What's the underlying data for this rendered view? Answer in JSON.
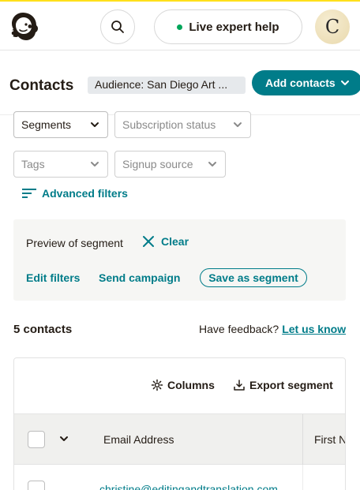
{
  "topbar": {
    "logo_icon": "mailchimp-freddie-icon",
    "search_icon": "search-icon",
    "expert_help_label": "Live expert help",
    "status_color": "#00a65a",
    "avatar_initial": "C"
  },
  "header": {
    "title": "Contacts",
    "audience": "Audience: San Diego Art ...",
    "add_contacts_label": "Add contacts",
    "accent_color": "#007c89"
  },
  "filters": {
    "segments": "Segments",
    "subscription_status": "Subscription status",
    "tags": "Tags",
    "signup_source": "Signup source",
    "advanced_filters": "Advanced filters"
  },
  "preview": {
    "label": "Preview of segment",
    "clear_label": "Clear",
    "edit_filters": "Edit filters",
    "send_campaign": "Send campaign",
    "save_as_segment": "Save as segment"
  },
  "summary": {
    "count": "5 contacts",
    "feedback_text": "Have feedback?",
    "feedback_link": "Let us know"
  },
  "table": {
    "columns_label": "Columns",
    "export_label": "Export segment",
    "headers": [
      "Email Address",
      "First N"
    ],
    "rows": [
      {
        "email": "christine@editingandtranslation.com"
      }
    ]
  }
}
